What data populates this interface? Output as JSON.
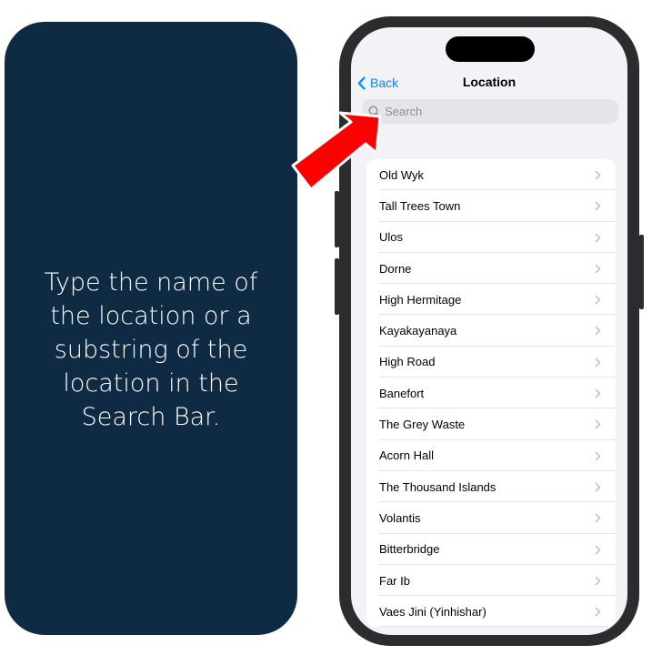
{
  "instruction": {
    "text": "Type the name of the location or a substring of the location in the Search Bar."
  },
  "nav": {
    "back_label": "Back",
    "title": "Location"
  },
  "search": {
    "placeholder": "Search"
  },
  "locations": [
    "Old Wyk",
    "Tall Trees Town",
    "Ulos",
    "Dorne",
    "High Hermitage",
    "Kayakayanaya",
    "High Road",
    "Banefort",
    "The Grey Waste",
    "Acorn Hall",
    "The Thousand Islands",
    "Volantis",
    "Bitterbridge",
    "Far Ib",
    "Vaes Jini (Yinhishar)"
  ],
  "icons": {
    "back": "chevron-left-icon",
    "search": "search-icon",
    "row": "chevron-right-icon",
    "callout": "red-arrow-icon"
  },
  "colors": {
    "panel_bg": "#0f2b44",
    "accent": "#0a84ff",
    "arrow": "#ff0000"
  }
}
